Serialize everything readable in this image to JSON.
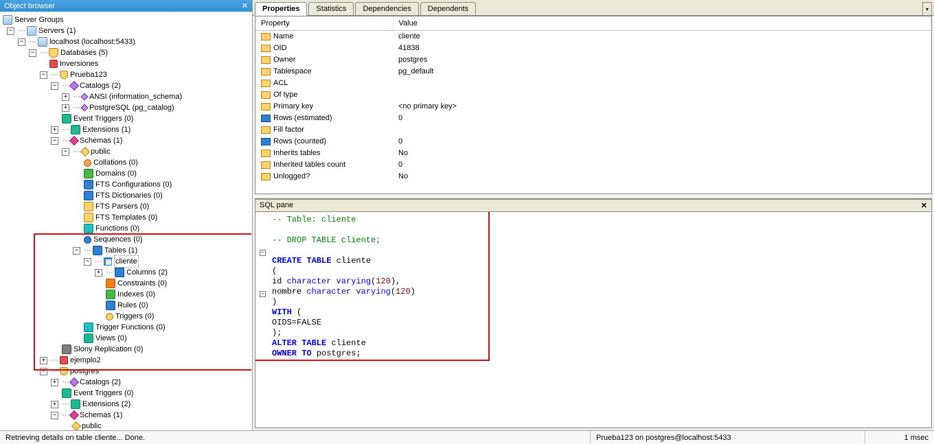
{
  "sidebar": {
    "title": "Object browser",
    "root": "Server Groups",
    "servers": "Servers (1)",
    "host": "localhost (localhost:5433)",
    "databases": "Databases (5)",
    "db_inversiones": "Inversiones",
    "db_prueba": "Prueba123",
    "catalogs": "Catalogs (2)",
    "ansi": "ANSI (information_schema)",
    "pg": "PostgreSQL (pg_catalog)",
    "event_triggers": "Event Triggers (0)",
    "extensions": "Extensions (1)",
    "schemas": "Schemas (1)",
    "public": "public",
    "collations": "Collations (0)",
    "domains": "Domains (0)",
    "ftsconf": "FTS Configurations (0)",
    "ftsdict": "FTS Dictionaries (0)",
    "ftspars": "FTS Parsers (0)",
    "ftstmpl": "FTS Templates (0)",
    "functions": "Functions (0)",
    "sequences": "Sequences (0)",
    "tables": "Tables (1)",
    "cliente": "cliente",
    "columns": "Columns (2)",
    "constraints": "Constraints (0)",
    "indexes": "Indexes (0)",
    "rules": "Rules (0)",
    "triggers": "Triggers (0)",
    "trigfunc": "Trigger Functions (0)",
    "views": "Views (0)",
    "slony": "Slony Replication (0)",
    "ejemplo2": "ejemplo2",
    "postgres_db": "postgres",
    "pg_catalogs": "Catalogs (2)",
    "pg_evtrig": "Event Triggers (0)",
    "pg_ext": "Extensions (2)",
    "pg_schemas": "Schemas (1)",
    "pg_public": "public"
  },
  "tabs": {
    "properties": "Properties",
    "statistics": "Statistics",
    "dependencies": "Dependencies",
    "dependents": "Dependents"
  },
  "props": {
    "header_prop": "Property",
    "header_val": "Value",
    "rows": [
      {
        "k": "Name",
        "v": "cliente"
      },
      {
        "k": "OID",
        "v": "41838"
      },
      {
        "k": "Owner",
        "v": "postgres"
      },
      {
        "k": "Tablespace",
        "v": "pg_default"
      },
      {
        "k": "ACL",
        "v": ""
      },
      {
        "k": "Of type",
        "v": ""
      },
      {
        "k": "Primary key",
        "v": "<no primary key>"
      },
      {
        "k": "Rows (estimated)",
        "v": "0"
      },
      {
        "k": "Fill factor",
        "v": ""
      },
      {
        "k": "Rows (counted)",
        "v": "0"
      },
      {
        "k": "Inherits tables",
        "v": "No"
      },
      {
        "k": "Inherited tables count",
        "v": "0"
      },
      {
        "k": "Unlogged?",
        "v": "No"
      }
    ]
  },
  "sqlpane": {
    "title": "SQL pane",
    "l1": "-- Table: cliente",
    "l2": "",
    "l3": "-- DROP TABLE cliente;",
    "l4": "",
    "l5a": "CREATE TABLE",
    "l5b": " cliente",
    "l6": "(",
    "l7a": "  id ",
    "l7b": "character varying",
    "l7c": "(",
    "l7d": "120",
    "l7e": "),",
    "l8a": "  nombre ",
    "l8b": "character varying",
    "l8c": "(",
    "l8d": "120",
    "l8e": ")",
    "l9": ")",
    "l10a": "WITH",
    "l10b": " (",
    "l11": "  OIDS=FALSE",
    "l12": ");",
    "l13a": "ALTER TABLE",
    "l13b": " cliente",
    "l14a": "  OWNER TO",
    "l14b": " postgres;"
  },
  "status": {
    "left": "Retrieving details on table cliente... Done.",
    "mid": "Prueba123 on postgres@localhost:5433",
    "right": "1 msec"
  }
}
